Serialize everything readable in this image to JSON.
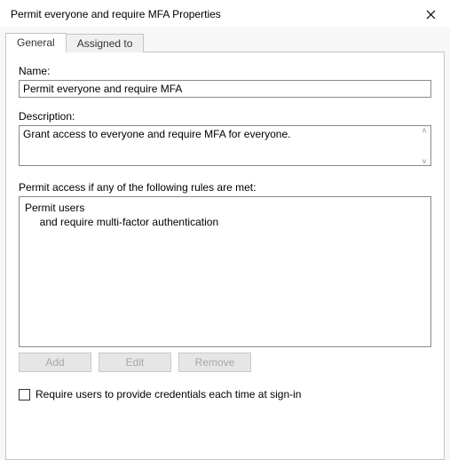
{
  "window": {
    "title": "Permit everyone and require MFA Properties"
  },
  "tabs": {
    "general": "General",
    "assigned_to": "Assigned to"
  },
  "general": {
    "name_label": "Name:",
    "name_value": "Permit everyone and require MFA",
    "description_label": "Description:",
    "description_value": "Grant access to everyone and require MFA for everyone.",
    "rules_label": "Permit access if any of the following rules are met:",
    "rules_text": "Permit users\n     and require multi-factor authentication",
    "buttons": {
      "add": "Add",
      "edit": "Edit",
      "remove": "Remove"
    },
    "checkbox_label": "Require users to provide credentials each time at sign-in"
  }
}
